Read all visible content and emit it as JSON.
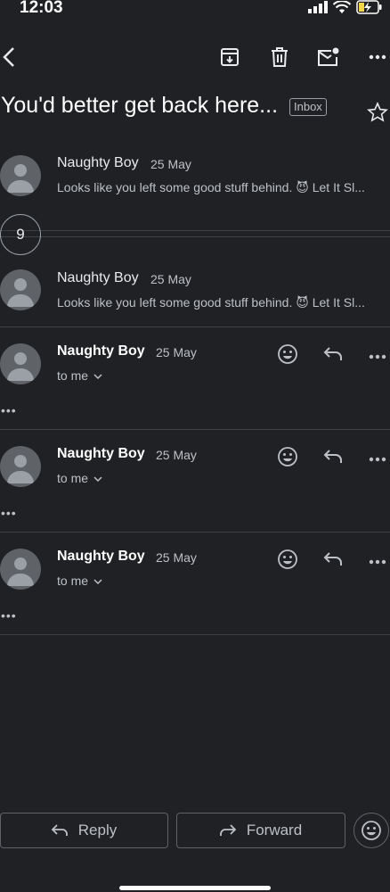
{
  "status_bar": {
    "time": "12:03"
  },
  "toolbar": {
    "back_icon": "back-arrow-icon",
    "archive_icon": "archive-icon",
    "delete_icon": "trash-icon",
    "mark_unread_icon": "mark-unread-icon",
    "more_icon": "more-horizontal-icon"
  },
  "thread": {
    "subject": "You'd better get back here...",
    "label": "Inbox",
    "collapsed_count": "9"
  },
  "messages_collapsed": [
    {
      "sender": "Naughty Boy",
      "date": "25 May",
      "snippet": "Looks like you left some good stuff behind. 😈 Let It Sl..."
    },
    {
      "sender": "Naughty Boy",
      "date": "25 May",
      "snippet": "Looks like you left some good stuff behind. 😈 Let It Sl..."
    }
  ],
  "messages_expanded": [
    {
      "sender": "Naughty Boy",
      "date": "25 May",
      "recipient": "to me",
      "trimmed": "•••"
    },
    {
      "sender": "Naughty Boy",
      "date": "25 May",
      "recipient": "to me",
      "trimmed": "•••"
    },
    {
      "sender": "Naughty Boy",
      "date": "25 May",
      "recipient": "to me",
      "trimmed": "•••"
    }
  ],
  "bottom_bar": {
    "reply_label": "Reply",
    "forward_label": "Forward"
  },
  "colors": {
    "background": "#202124",
    "text": "#e8eaed",
    "muted": "#bdc1c6",
    "avatar": "#5f6368"
  }
}
